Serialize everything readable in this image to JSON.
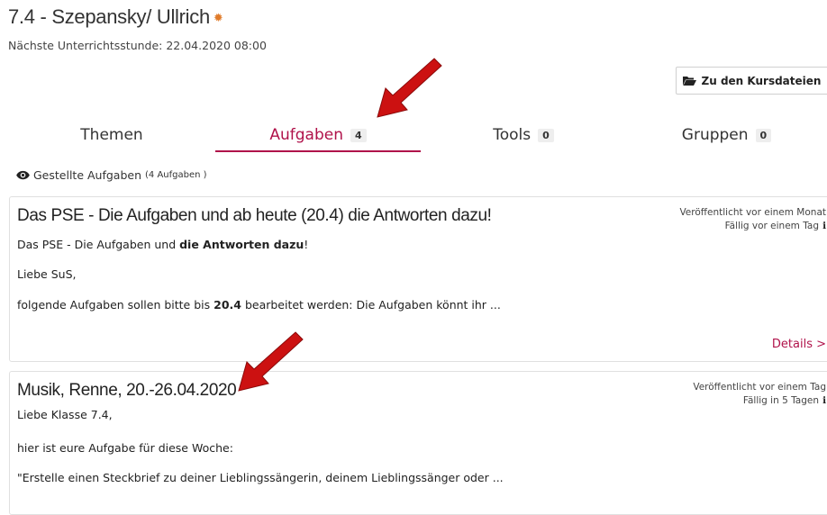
{
  "course": {
    "title": "7.4 - Szepansky/ Ullrich",
    "next_lesson": "Nächste Unterrichtsstunde: 22.04.2020 08:00",
    "files_button": "Zu den Kursdateien"
  },
  "tabs": [
    {
      "label": "Themen",
      "count": ""
    },
    {
      "label": "Aufgaben",
      "count": "4"
    },
    {
      "label": "Tools",
      "count": "0"
    },
    {
      "label": "Gruppen",
      "count": "0"
    }
  ],
  "section": {
    "label": "Gestellte Aufgaben",
    "count_text": "(4 Aufgaben )"
  },
  "tasks": [
    {
      "title": "Das PSE - Die Aufgaben und ab heute (20.4) die Antworten dazu!",
      "published": "Veröffentlicht vor einem Monat",
      "due": "Fällig vor einem Tag",
      "line1_pre": "Das PSE - Die Aufgaben und ",
      "line1_bold": "die Antworten dazu",
      "line1_post": "!",
      "line2": "Liebe SuS,",
      "line3_pre": "folgende Aufgaben sollen bitte bis ",
      "line3_bold": "20.4",
      "line3_post": " bearbeitet werden: Die Aufgaben könnt ihr ...",
      "details": "Details >"
    },
    {
      "title": "Musik, Renne, 20.-26.04.2020",
      "published": "Veröffentlicht vor einem Tag",
      "due": "Fällig in 5 Tagen",
      "line1": "Liebe Klasse 7.4,",
      "line2": "hier ist eure Aufgabe für diese Woche:",
      "line3": "\"Erstelle einen Steckbrief zu deiner Lieblingssängerin, deinem Lieblingssänger oder ..."
    }
  ],
  "colors": {
    "accent": "#b0124a",
    "arrow": "#cc1111",
    "gear": "#e07b2a"
  }
}
